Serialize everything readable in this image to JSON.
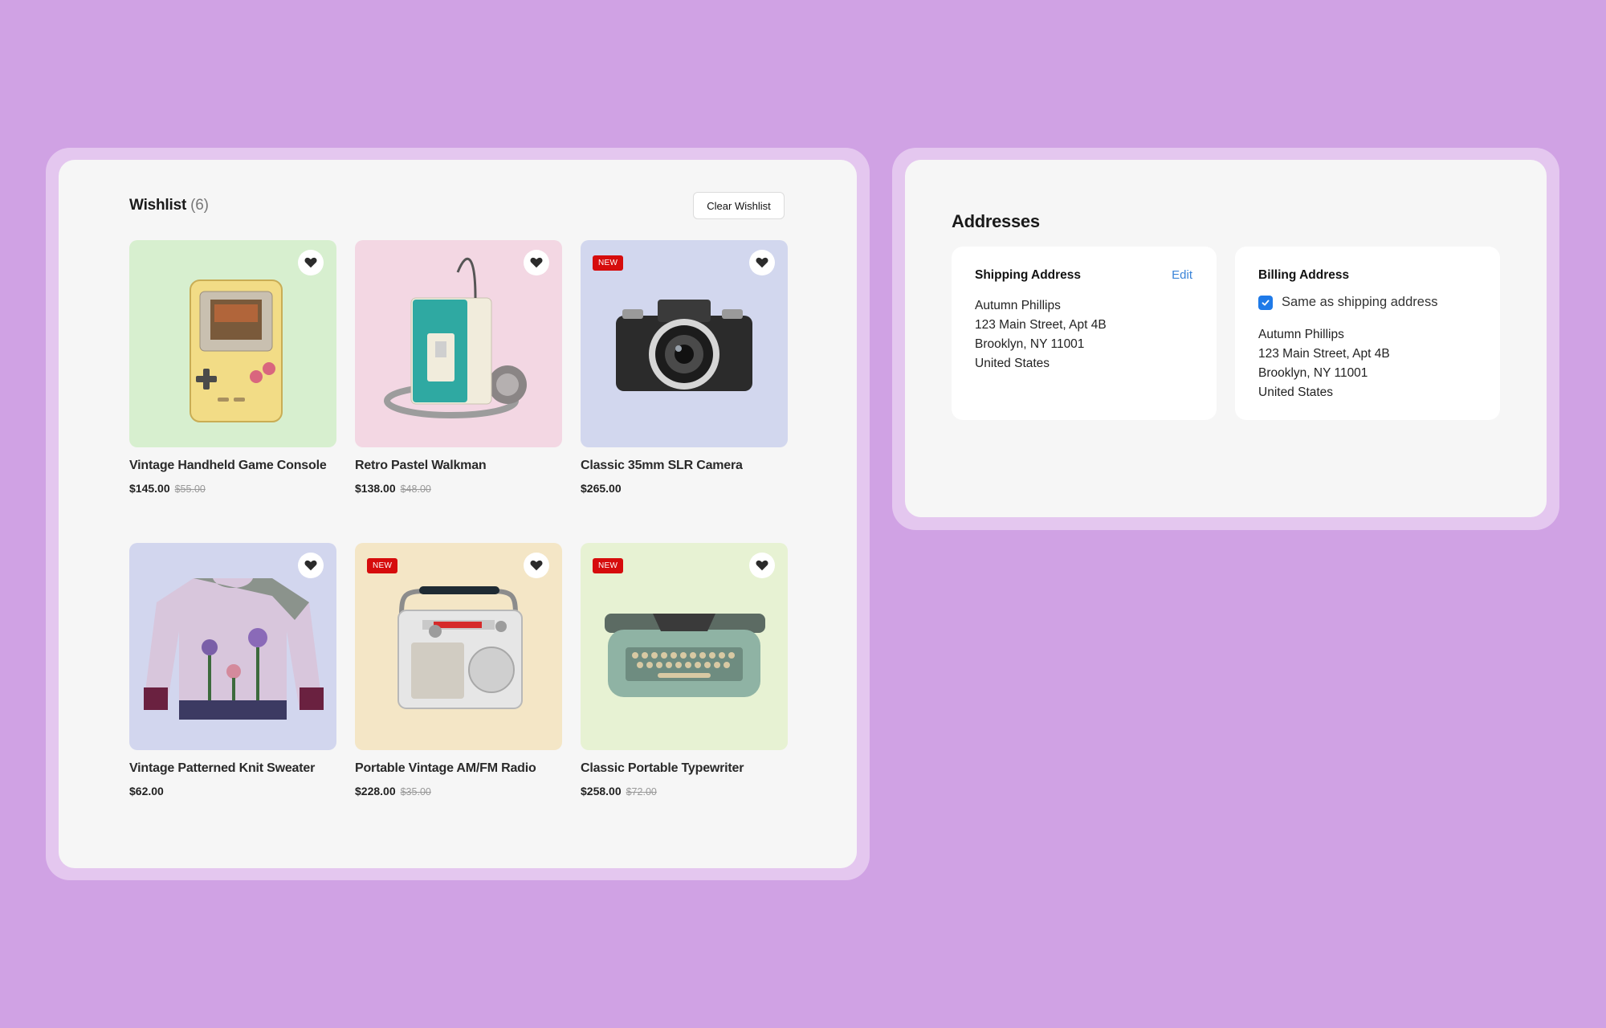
{
  "colors": {
    "background": "#d0a2e4",
    "badge": "#d60c0c",
    "link": "#3a84d8",
    "checkbox": "#1f7ae8"
  },
  "wishlist": {
    "title": "Wishlist",
    "count": "(6)",
    "clear_label": "Clear Wishlist",
    "items": [
      {
        "name": "Vintage Handheld Game Console",
        "price": "$145.00",
        "old_price": "$55.00",
        "badge": "",
        "bg": "#d7efcf",
        "icon": "game-console"
      },
      {
        "name": "Retro Pastel Walkman",
        "price": "$138.00",
        "old_price": "$48.00",
        "badge": "",
        "bg": "#f3d7e3",
        "icon": "walkman"
      },
      {
        "name": "Classic 35mm SLR Camera",
        "price": "$265.00",
        "old_price": "",
        "badge": "NEW",
        "bg": "#d2d7ee",
        "icon": "camera"
      },
      {
        "name": "Vintage Patterned Knit Sweater",
        "price": "$62.00",
        "old_price": "",
        "badge": "",
        "bg": "#d2d6ee",
        "icon": "sweater"
      },
      {
        "name": "Portable Vintage AM/FM Radio",
        "price": "$228.00",
        "old_price": "$35.00",
        "badge": "NEW",
        "bg": "#f4e6c6",
        "icon": "radio"
      },
      {
        "name": "Classic Portable Typewriter",
        "price": "$258.00",
        "old_price": "$72.00",
        "badge": "NEW",
        "bg": "#e7f2d3",
        "icon": "typewriter"
      }
    ]
  },
  "addresses": {
    "title": "Addresses",
    "shipping": {
      "heading": "Shipping Address",
      "edit_label": "Edit",
      "lines": [
        "Autumn Phillips",
        "123 Main Street, Apt 4B",
        "Brooklyn, NY 11001",
        "United States"
      ]
    },
    "billing": {
      "heading": "Billing Address",
      "same_label": "Same as shipping address",
      "same_checked": true,
      "lines": [
        "Autumn Phillips",
        "123 Main Street, Apt 4B",
        "Brooklyn, NY 11001",
        "United States"
      ]
    }
  }
}
